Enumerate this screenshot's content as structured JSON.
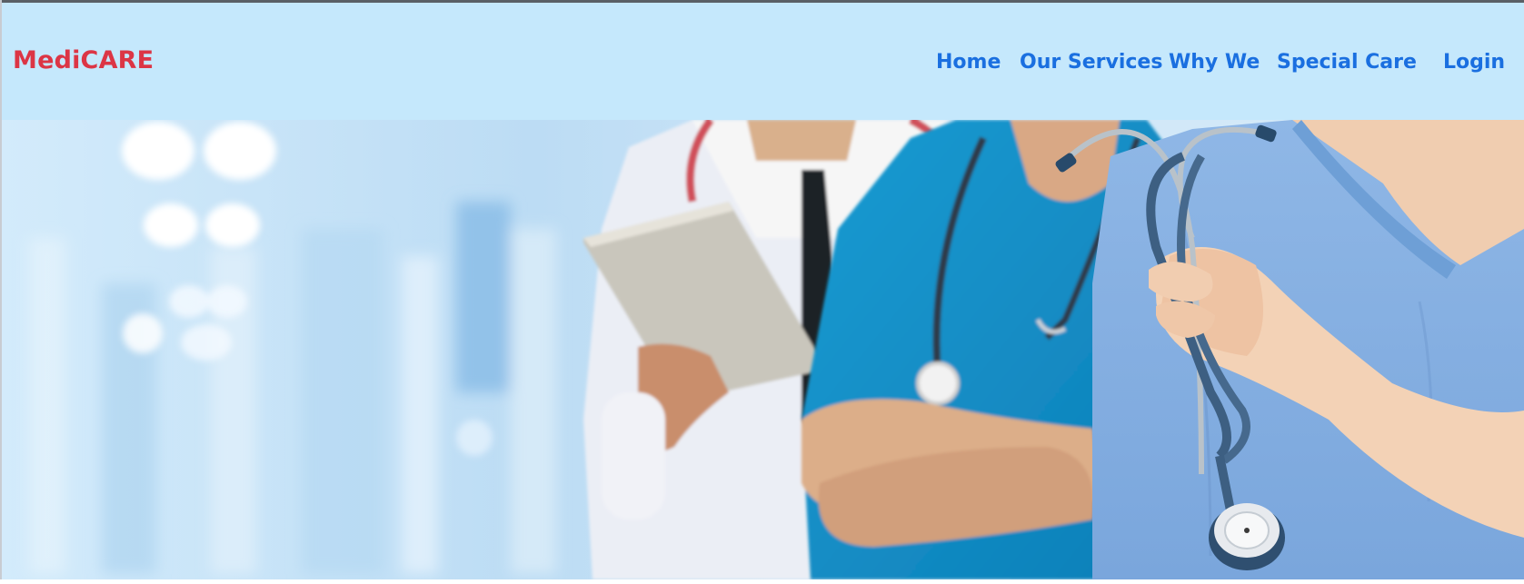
{
  "brand": {
    "name": "MediCARE",
    "color": "#dc3545"
  },
  "nav": {
    "home": "Home",
    "services": "Our Services",
    "why": "Why We",
    "special": "Special Care",
    "login": "Login",
    "link_color": "#1a6fe0",
    "background": "#c5e8fc"
  },
  "hero": {
    "image": "medical-team-photo",
    "background_color": "#cfe6f8"
  }
}
